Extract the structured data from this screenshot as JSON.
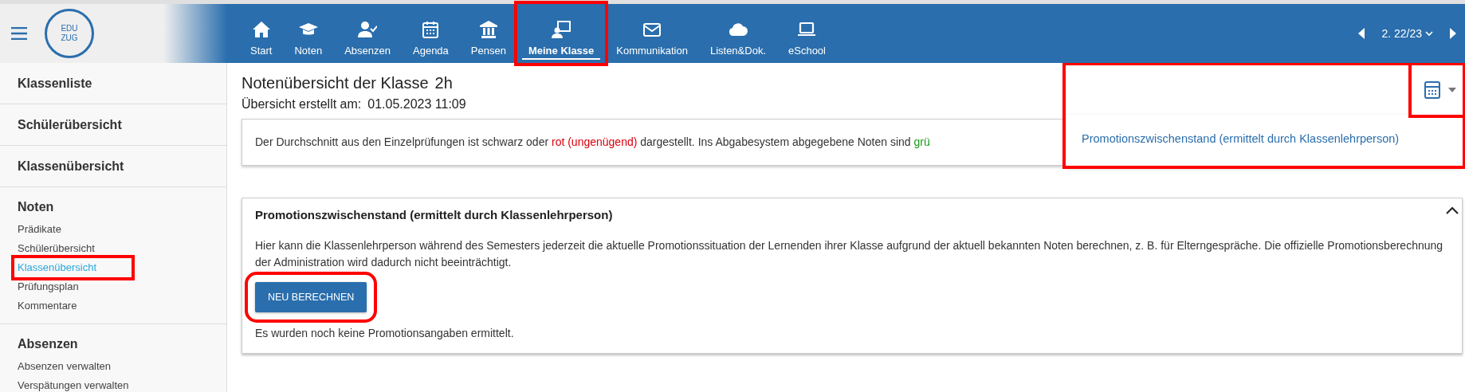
{
  "app": {
    "logo_lines": [
      "EDU",
      "ZUG"
    ]
  },
  "nav": [
    {
      "label": "Start",
      "selected": false,
      "highlighted": false
    },
    {
      "label": "Noten",
      "selected": false,
      "highlighted": false
    },
    {
      "label": "Absenzen",
      "selected": false,
      "highlighted": false
    },
    {
      "label": "Agenda",
      "selected": false,
      "highlighted": false
    },
    {
      "label": "Pensen",
      "selected": false,
      "highlighted": false
    },
    {
      "label": "Meine Klasse",
      "selected": true,
      "highlighted": true
    },
    {
      "label": "Kommunikation",
      "selected": false,
      "highlighted": false
    },
    {
      "label": "Listen&Dok.",
      "selected": false,
      "highlighted": false
    },
    {
      "label": "eSchool",
      "selected": false,
      "highlighted": false
    }
  ],
  "term": {
    "label": "2. 22/23"
  },
  "sidebar": {
    "sections": [
      {
        "title": "Klassenliste"
      },
      {
        "title": "Schülerübersicht"
      },
      {
        "title": "Klassenübersicht"
      },
      {
        "title": "Noten",
        "items": [
          {
            "label": "Prädikate",
            "selected": false,
            "highlighted": false
          },
          {
            "label": "Schülerübersicht",
            "selected": false,
            "highlighted": false
          },
          {
            "label": "Klassenübersicht",
            "selected": true,
            "highlighted": true
          },
          {
            "label": "Prüfungsplan",
            "selected": false,
            "highlighted": false
          },
          {
            "label": "Kommentare",
            "selected": false,
            "highlighted": false
          }
        ]
      },
      {
        "title": "Absenzen",
        "items": [
          {
            "label": "Absenzen verwalten",
            "selected": false,
            "highlighted": false
          },
          {
            "label": "Verspätungen verwalten",
            "selected": false,
            "highlighted": false
          }
        ]
      }
    ]
  },
  "page": {
    "title": "Notenübersicht der Klasse",
    "class_name": {
      "text": "2h"
    },
    "created": {
      "label": "Übersicht erstellt am:",
      "value": "01.05.2023 11:09"
    },
    "info": [
      {
        "text": "Der Durchschnitt aus den Einzelprüfungen ist schwarz oder ",
        "color": "#333333"
      },
      {
        "text": "rot (ungenügend)",
        "color": "#d9000d"
      },
      {
        "text": " dargestellt. Ins Abgabesystem abgegebene Noten sind ",
        "color": "#333333"
      },
      {
        "text": "grü",
        "color": "#1a9a1a"
      }
    ]
  },
  "dropdown": {
    "expanded": true,
    "highlighted": true,
    "toggle_highlighted": true,
    "items": [
      {
        "label": "Promotionszwischenstand (ermittelt durch Klassenlehrperson)"
      }
    ]
  },
  "card": {
    "title": "Promotionszwischenstand (ermittelt durch Klassenlehrperson)",
    "expanded": true,
    "description": "Hier kann die Klassenlehrperson während des Semesters jederzeit die aktuelle Promotionssituation der Lernenden ihrer Klasse aufgrund der aktuell bekannten Noten berechnen, z. B. für Elterngespräche. Die offizielle Promotionsberechnung der Administration wird dadurch nicht beeinträchtigt.",
    "button": {
      "label": "NEU BERECHNEN",
      "highlighted": true
    },
    "status": "Es wurden noch keine Promotionsangaben ermittelt."
  }
}
